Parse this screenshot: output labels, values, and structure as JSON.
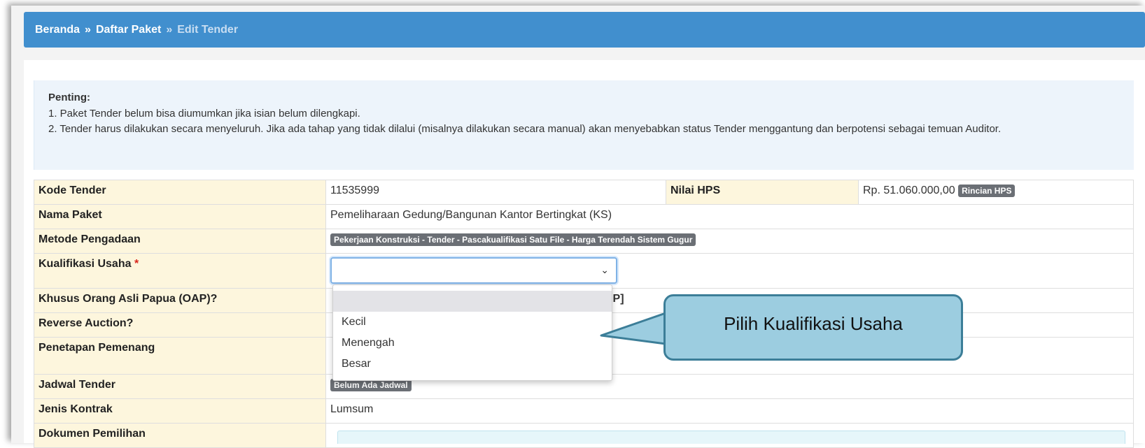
{
  "breadcrumb": {
    "home": "Beranda",
    "separator": "»",
    "list": "Daftar Paket",
    "current": "Edit Tender"
  },
  "notice": {
    "title": "Penting:",
    "items": [
      "1. Paket Tender belum bisa diumumkan jika isian belum dilengkapi.",
      "2. Tender harus dilakukan secara menyeluruh. Jika ada tahap yang tidak dilalui (misalnya dilakukan secara manual) akan menyebabkan status Tender menggantung dan berpotensi sebagai temuan Auditor."
    ]
  },
  "form": {
    "kode_tender_label": "Kode Tender",
    "kode_tender": "11535999",
    "nilai_hps_label": "Nilai HPS",
    "nilai_hps": "Rp. 51.060.000,00",
    "rincian_hps": "Rincian HPS",
    "nama_paket_label": "Nama Paket",
    "nama_paket": "Pemeliharaan Gedung/Bangunan Kantor Bertingkat (KS)",
    "metode_label": "Metode Pengadaan",
    "metode": "Pekerjaan Konstruksi - Tender - Pascakualifikasi Satu File - Harga Terendah Sistem Gugur",
    "kualifikasi_label": "Kualifikasi Usaha",
    "required_mark": "*",
    "kualifikasi_value": "",
    "oap_label": "Khusus Orang Asli Papua (OAP)?",
    "oap_value_partial": "AP]",
    "reverse_label": "Reverse Auction?",
    "penetapan_label": "Penetapan Pemenang",
    "jadwal_label": "Jadwal Tender",
    "jadwal_value": "Belum Ada Jadwal",
    "jenis_kontrak_label": "Jenis Kontrak",
    "jenis_kontrak_value": "Lumsum",
    "partial_label": "Dokumen Pemilihan"
  },
  "dropdown": {
    "options": [
      "",
      "Kecil",
      "Menengah",
      "Besar"
    ]
  },
  "callout": {
    "text": "Pilih Kualifikasi Usaha"
  },
  "colors": {
    "header_bg": "#418fce",
    "label_bg": "#fdf6dd",
    "notice_bg": "#edf4fb",
    "callout_bg": "#9ccde0",
    "callout_border": "#3c7e98",
    "badge_bg": "#6b6f75"
  }
}
